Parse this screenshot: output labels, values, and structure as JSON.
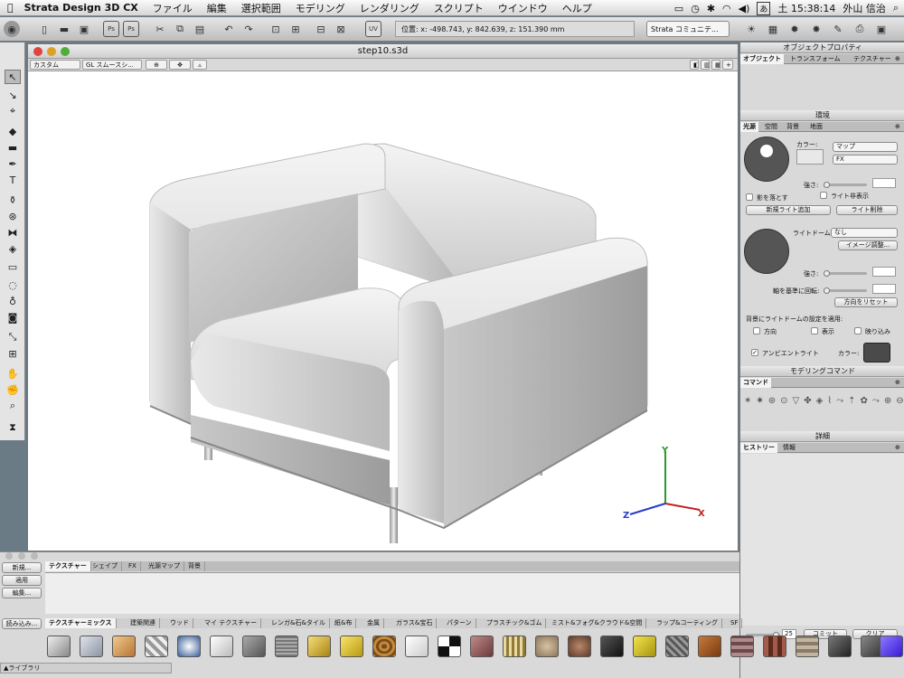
{
  "menubar": {
    "app_name": "Strata Design 3D CX",
    "items": [
      "ファイル",
      "編集",
      "選択範囲",
      "モデリング",
      "レンダリング",
      "スクリプト",
      "ウインドウ",
      "ヘルプ"
    ],
    "clock": "土 15:38:14",
    "user": "外山 信治",
    "ime": "あ"
  },
  "toolbar": {
    "coordinates": "位置: x: -498.743, y: 842.639, z: 151.390 mm",
    "community_select": "Strata コミュニテ...",
    "ps_label": "Ps",
    "uv_label": "UV"
  },
  "document": {
    "title": "step10.s3d",
    "view_select": "カスタム",
    "render_select": "GL スムースシ..."
  },
  "axes": {
    "x": "X",
    "y": "Y",
    "z": "Z"
  },
  "panels": {
    "object_props": {
      "title": "オブジェクトプロパティ",
      "tabs": [
        "オブジェクト",
        "トランスフォーム",
        "テクスチャー"
      ]
    },
    "environment": {
      "title": "環境",
      "tabs": [
        "光源",
        "空間",
        "背景",
        "地面"
      ],
      "color_label": "カラー:",
      "map_select": "マップ",
      "fx_select": "FX",
      "intensity_label": "強さ:",
      "cast_shadow": "影を落とす",
      "hide_light": "ライト非表示",
      "add_light": "新規ライト追加",
      "delete_light": "ライト削除",
      "lightdome_label": "ライトドーム:",
      "lightdome_select": "なし",
      "image_adjust": "イメージ調整...",
      "intensity2_label": "強さ:",
      "rotate_label": "軸を基準に回転:",
      "reset_dir": "方向をリセット",
      "apply_label": "背景にライトドームの設定を適用:",
      "opt_direction": "方向",
      "opt_display": "表示",
      "opt_reflect": "映り込み",
      "ambient": "アンビエントライト",
      "ambient_color_label": "カラー:"
    },
    "modeling": {
      "title": "モデリングコマンド",
      "tab": "コマンド"
    },
    "details": {
      "title": "詳細",
      "tabs": [
        "ヒストリー",
        "情報"
      ],
      "value": "25",
      "commit": "コミット",
      "clear": "クリア"
    }
  },
  "bottom": {
    "tabs": [
      "テクスチャー",
      "シェイプ",
      "FX",
      "光源マップ",
      "背景"
    ],
    "new_btn": "新規...",
    "apply_btn": "適用",
    "edit_btn": "編集...",
    "load_btn": "読み込み...",
    "categories": [
      "テクスチャーミックス",
      "建築関連",
      "ウッド",
      "マイ テクスチャー",
      "レンガ&石&タイル",
      "紙&布",
      "金属",
      "ガラス&宝石",
      "パターン",
      "プラスチック&ゴム",
      "ミスト&フォグ&クラウド&空間",
      "ラップ&コーティング",
      "SF"
    ],
    "library": "▲ライブラリ"
  }
}
